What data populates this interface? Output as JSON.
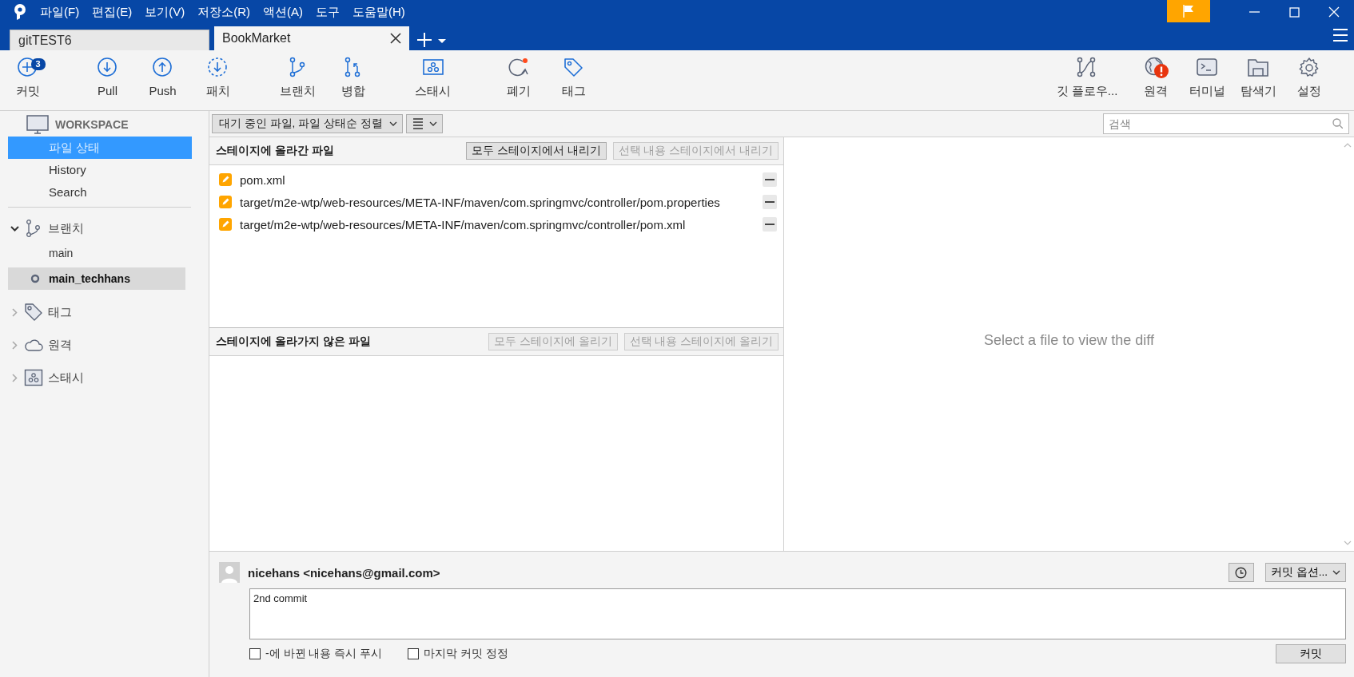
{
  "menu": [
    "파일(F)",
    "편집(E)",
    "보기(V)",
    "저장소(R)",
    "액션(A)",
    "도구",
    "도움말(H)"
  ],
  "tabs": [
    {
      "label": "gitTEST6",
      "selected": false
    },
    {
      "label": "BookMarket",
      "selected": true
    }
  ],
  "toolbar": {
    "left": [
      {
        "kind": "commit",
        "label": "커밋",
        "badge": "3"
      },
      {
        "kind": "pull",
        "label": "Pull"
      },
      {
        "kind": "push",
        "label": "Push"
      },
      {
        "kind": "patch",
        "label": "패치"
      },
      {
        "kind": "branch",
        "label": "브랜치"
      },
      {
        "kind": "merge",
        "label": "병합"
      },
      {
        "kind": "stash",
        "label": "스태시"
      },
      {
        "kind": "discard",
        "label": "폐기"
      },
      {
        "kind": "tag",
        "label": "태그"
      }
    ],
    "right": [
      {
        "kind": "gitflow",
        "label": "깃 플로우..."
      },
      {
        "kind": "remote",
        "label": "원격",
        "alert": true
      },
      {
        "kind": "terminal",
        "label": "터미널"
      },
      {
        "kind": "explorer",
        "label": "탐색기"
      },
      {
        "kind": "settings",
        "label": "설정"
      }
    ]
  },
  "sidebar": {
    "workspace": {
      "title": "WORKSPACE",
      "items": [
        {
          "label": "파일 상태",
          "selected": true
        },
        {
          "label": "History",
          "selected": false
        },
        {
          "label": "Search",
          "selected": false
        }
      ]
    },
    "sections": [
      {
        "kind": "branch",
        "label": "브랜치",
        "expanded": true,
        "children": [
          {
            "label": "main",
            "current": false,
            "selected": false
          },
          {
            "label": "main_techhans",
            "current": true,
            "selected": true
          }
        ]
      },
      {
        "kind": "tag",
        "label": "태그",
        "expanded": false
      },
      {
        "kind": "remote",
        "label": "원격",
        "expanded": false
      },
      {
        "kind": "stash",
        "label": "스태시",
        "expanded": false
      }
    ]
  },
  "filter": {
    "sort": "대기 중인 파일, 파일 상태순 정렬"
  },
  "search": {
    "placeholder": "검색"
  },
  "staged": {
    "title": "스테이지에 올라간 파일",
    "buttons": [
      {
        "label": "모두 스테이지에서 내리기",
        "disabled": false
      },
      {
        "label": "선택 내용 스테이지에서 내리기",
        "disabled": true
      }
    ],
    "files": [
      {
        "path": "pom.xml",
        "modified": true
      },
      {
        "path": "target/m2e-wtp/web-resources/META-INF/maven/com.springmvc/controller/pom.properties",
        "modified": true
      },
      {
        "path": "target/m2e-wtp/web-resources/META-INF/maven/com.springmvc/controller/pom.xml",
        "modified": true
      }
    ]
  },
  "unstaged": {
    "title": "스테이지에 올라가지 않은 파일",
    "buttons": [
      {
        "label": "모두 스테이지에 올리기",
        "disabled": true
      },
      {
        "label": "선택 내용 스테이지에 올리기",
        "disabled": true
      }
    ]
  },
  "diff": {
    "message": "Select a file to view the diff"
  },
  "commit": {
    "author": "nicehans <nicehans@gmail.com>",
    "options": "커밋 옵션...",
    "message": "2nd commit",
    "checkboxes": [
      {
        "label": "-에 바뀐 내용 즉시 푸시",
        "checked": false
      },
      {
        "label": "마지막 커밋 정정",
        "checked": false
      }
    ],
    "button": "커밋"
  }
}
